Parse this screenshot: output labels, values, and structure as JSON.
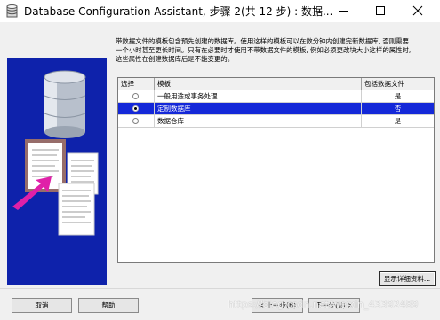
{
  "window": {
    "title": "Database Configuration Assistant, 步骤 2(共 12 步) : 数据...",
    "controls": [
      "minimize-icon",
      "maximize-icon",
      "close-icon"
    ]
  },
  "description": {
    "line1": "带数据文件的模板包含预先创建的数据库。使用这样的模板可以在数分钟内创建完新数据库, 否则需要",
    "line2": "一个小时甚至更长时间。只有在必要时才使用不带数据文件的模板, 例如必须更改块大小这样的属性时,",
    "line3": "这些属性在创建数据库后是不能变更的。"
  },
  "templates": {
    "headers": {
      "select": "选择",
      "template": "模板",
      "includes": "包括数据文件"
    },
    "rows": [
      {
        "name": "一般用途或事务处理",
        "includes": "是",
        "selected": false
      },
      {
        "name": "定制数据库",
        "includes": "否",
        "selected": true
      },
      {
        "name": "数据仓库",
        "includes": "是",
        "selected": false
      }
    ]
  },
  "buttons": {
    "details": "显示详细资料...",
    "cancel": "取消",
    "help": "帮助",
    "prev": "< 上一步(B)",
    "next": "下一步(N) >"
  },
  "watermark": "https://blog.csdn.net/weixin_43392489",
  "colors": {
    "selection": "#1428d8",
    "illustration_bg": "#0a1a9c"
  }
}
